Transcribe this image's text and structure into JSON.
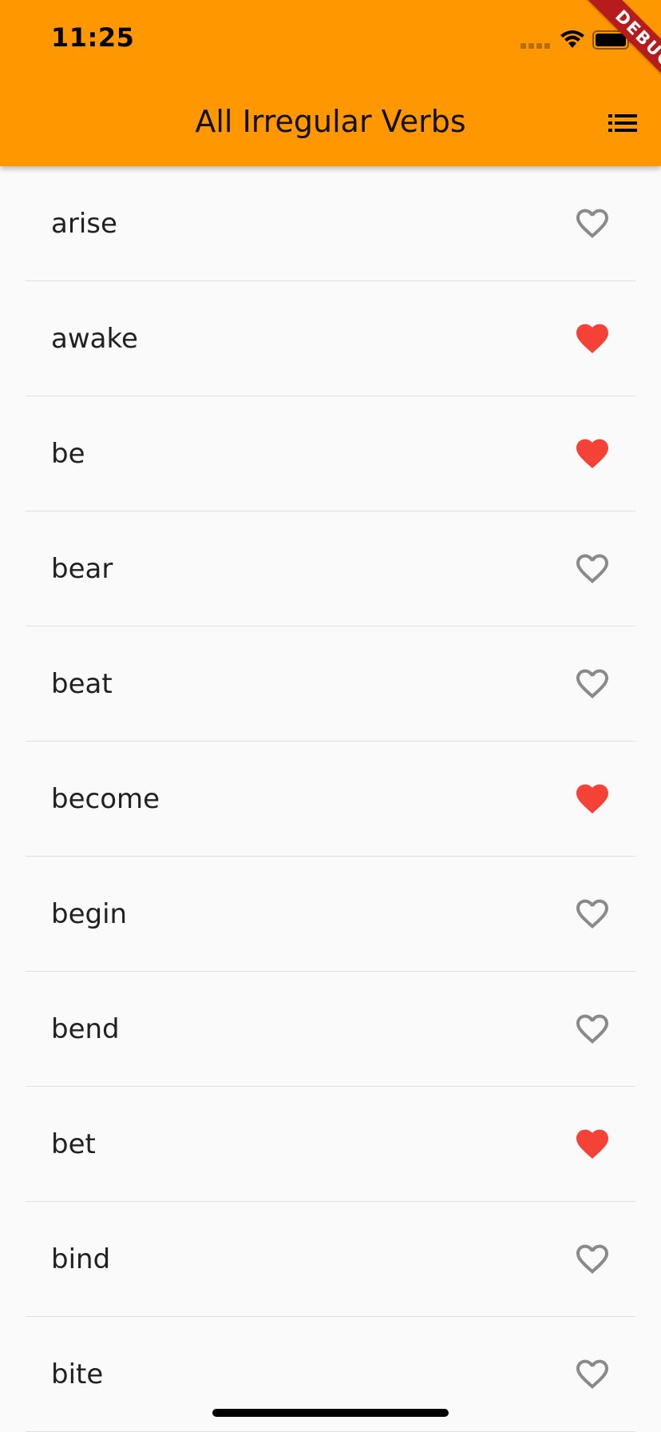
{
  "status_bar": {
    "time": "11:25"
  },
  "app_bar": {
    "title": "All Irregular Verbs",
    "menu_icon": "list-icon",
    "background": "#ff9800"
  },
  "debug_banner": {
    "label": "DEBUG"
  },
  "verbs": [
    {
      "word": "arise",
      "favorite": false
    },
    {
      "word": "awake",
      "favorite": true
    },
    {
      "word": "be",
      "favorite": true
    },
    {
      "word": "bear",
      "favorite": false
    },
    {
      "word": "beat",
      "favorite": false
    },
    {
      "word": "become",
      "favorite": true
    },
    {
      "word": "begin",
      "favorite": false
    },
    {
      "word": "bend",
      "favorite": false
    },
    {
      "word": "bet",
      "favorite": true
    },
    {
      "word": "bind",
      "favorite": false
    },
    {
      "word": "bite",
      "favorite": false
    }
  ],
  "colors": {
    "favorite": "#f44336",
    "not_favorite": "#8a8a8a"
  }
}
